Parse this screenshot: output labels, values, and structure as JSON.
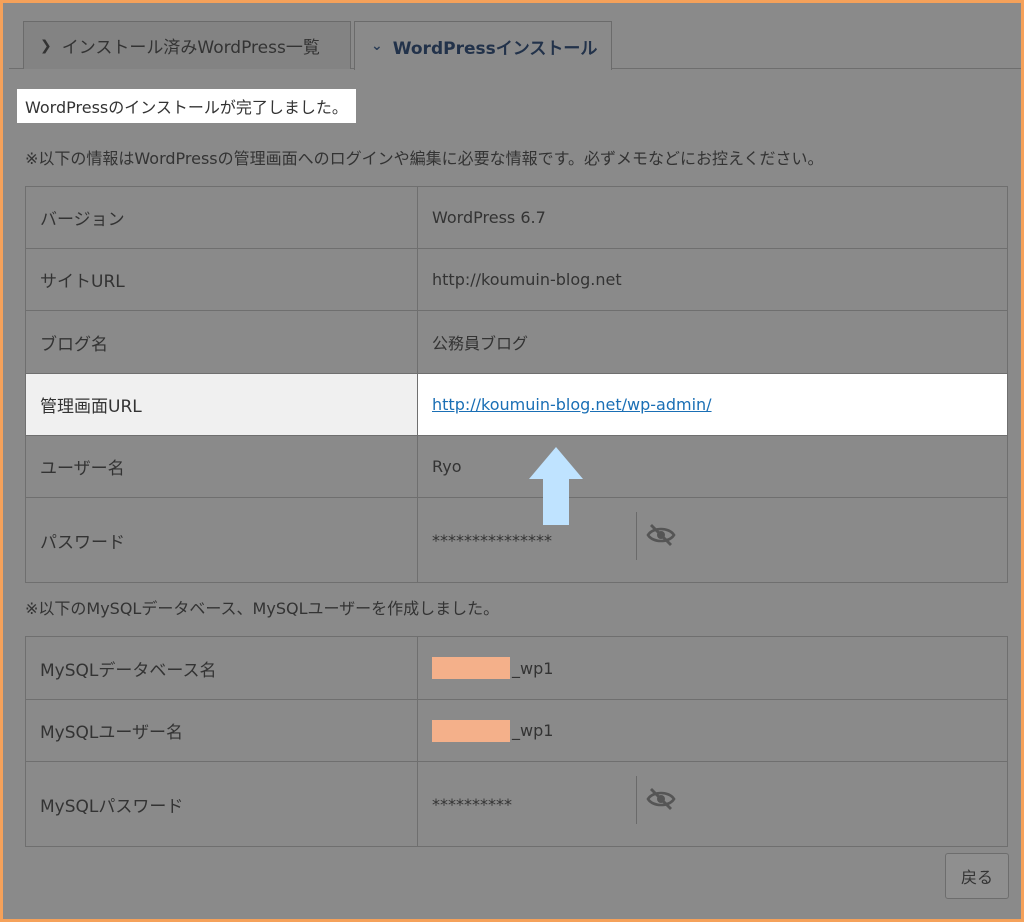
{
  "tabs": [
    {
      "label": "インストール済みWordPress一覧",
      "icon": "chevron-right-icon"
    },
    {
      "label": "WordPressインストール",
      "icon": "chevron-down-icon"
    }
  ],
  "done_message": "WordPressのインストールが完了しました。",
  "note1": "※以下の情報はWordPressの管理画面へのログインや編集に必要な情報です。必ずメモなどにお控えください。",
  "wp_info": [
    {
      "label": "バージョン",
      "value": "WordPress 6.7"
    },
    {
      "label": "サイトURL",
      "value": "http://koumuin-blog.net"
    },
    {
      "label": "ブログ名",
      "value": "公務員ブログ"
    },
    {
      "label": "管理画面URL",
      "value": "http://koumuin-blog.net/wp-admin/"
    },
    {
      "label": "ユーザー名",
      "value": "Ryo"
    },
    {
      "label": "パスワード",
      "value": "***************"
    }
  ],
  "note2": "※以下のMySQLデータベース、MySQLユーザーを作成しました。",
  "mysql_info": [
    {
      "label": "MySQLデータベース名",
      "value": "_wp1"
    },
    {
      "label": "MySQLユーザー名",
      "value": "_wp1"
    },
    {
      "label": "MySQLパスワード",
      "value": "**********"
    }
  ],
  "back_button": "戻る",
  "colors": {
    "accent_border": "#f5a15a",
    "link": "#1a6fb5",
    "arrow": "#bfe3ff",
    "redaction": "#f4b08a"
  },
  "icons": {
    "password_toggle": "eye-off-icon",
    "arrow": "up-arrow-icon"
  }
}
